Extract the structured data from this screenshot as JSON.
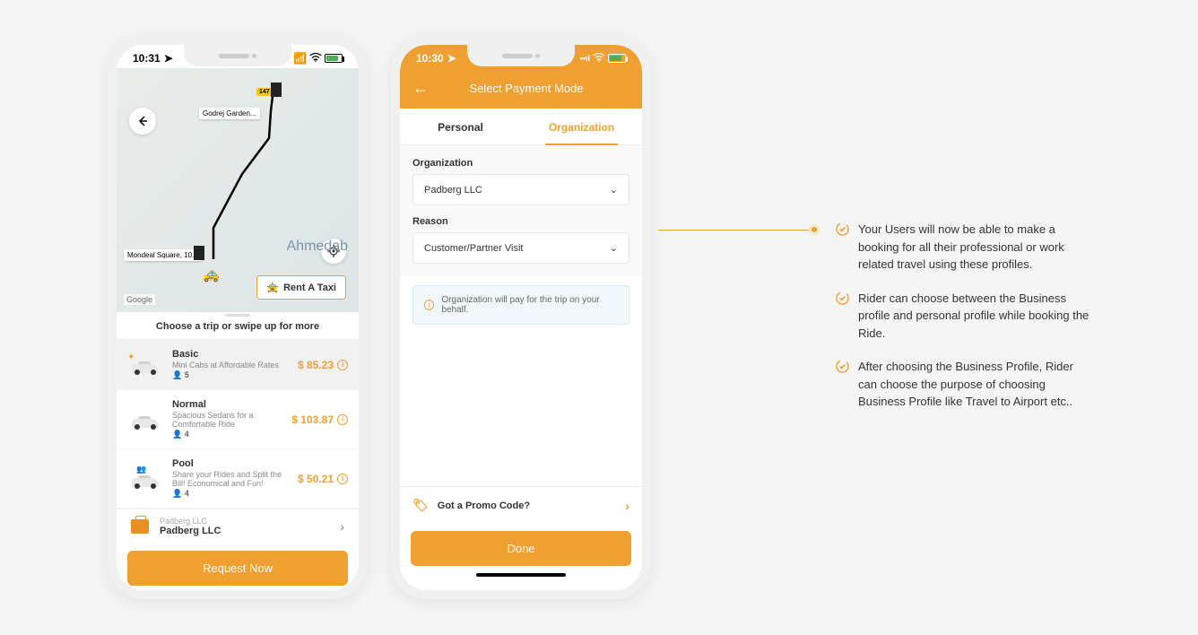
{
  "phone1": {
    "status_time": "10:31",
    "map": {
      "city_label": "Ahmedab",
      "start_label": "Mondeal Square, 10...",
      "mid_label": "Godrej Garden...",
      "rent_label": "Rent A Taxi",
      "google": "Google",
      "route_badge": "147"
    },
    "trip_header": "Choose a trip or swipe up for more",
    "trips": [
      {
        "name": "Basic",
        "desc": "Mini Cabs at Affordable Rates",
        "capacity": "👤 5",
        "price": "$ 85.23"
      },
      {
        "name": "Normal",
        "desc": "Spacious Sedans for a Comfortable Ride",
        "capacity": "👤 4",
        "price": "$ 103.87"
      },
      {
        "name": "Pool",
        "desc": "Share your Rides and Split the Bill! Economical and Fun!",
        "capacity": "👤 4",
        "price": "$ 50.21"
      }
    ],
    "org": {
      "sub": "Padberg LLC",
      "main": "Padberg LLC"
    },
    "request_btn": "Request Now"
  },
  "phone2": {
    "status_time": "10:30",
    "header_title": "Select Payment Mode",
    "tabs": {
      "personal": "Personal",
      "organization": "Organization"
    },
    "form": {
      "org_label": "Organization",
      "org_value": "Padberg LLC",
      "reason_label": "Reason",
      "reason_value": "Customer/Partner Visit"
    },
    "info_text": "Organization will pay for the trip on your behalf.",
    "promo_label": "Got a Promo Code?",
    "done_btn": "Done"
  },
  "annotations": [
    "Your Users will now be able to make a booking for all their professional or work related travel using these profiles.",
    "Rider can choose between the Business profile and personal profile while booking the Ride.",
    "After choosing the Business Profile, Rider can choose the purpose of choosing Business Profile like Travel to Airport etc.."
  ]
}
